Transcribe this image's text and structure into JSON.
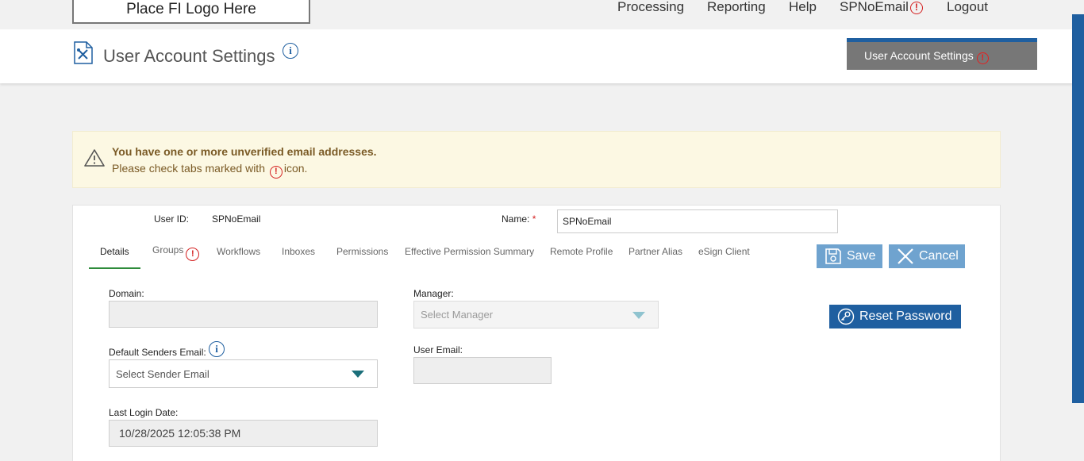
{
  "topbar": {
    "logo_text": "Place FI Logo Here",
    "nav": {
      "processing": "Processing",
      "reporting": "Reporting",
      "help": "Help",
      "user": "SPNoEmail",
      "logout": "Logout"
    },
    "warn_symbol": "!"
  },
  "header": {
    "title": "User Account Settings",
    "info_symbol": "i",
    "tab_label": "User Account Settings"
  },
  "alert": {
    "title": "You have one or more unverified email addresses.",
    "text_before": "Please check tabs marked with",
    "text_after": "icon."
  },
  "form": {
    "user_id_label": "User ID:",
    "user_id_value": "SPNoEmail",
    "name_label": "Name:",
    "required_mark": "*",
    "name_value": "SPNoEmail",
    "tabs": [
      "Details",
      "Groups",
      "Workflows",
      "Inboxes",
      "Permissions",
      "Effective Permission Summary",
      "Remote Profile",
      "Partner Alias",
      "eSign Client"
    ],
    "active_tab": "Details",
    "save_label": "Save",
    "cancel_label": "Cancel",
    "reset_password_label": "Reset Password",
    "domain_label": "Domain:",
    "domain_value": "",
    "manager_label": "Manager:",
    "manager_placeholder": "Select Manager",
    "default_senders_label": "Default Senders Email:",
    "sender_placeholder": "Select Sender Email",
    "user_email_label": "User Email:",
    "user_email_value": "",
    "last_login_label": "Last Login Date:",
    "last_login_value": "10/28/2025 12:05:38 PM"
  },
  "colors": {
    "primary": "#1f5fa0",
    "button_light": "#6fa3cf",
    "warning": "#d42020",
    "alert_bg": "#fcf8e3",
    "active_tab_underline": "#2e8b3b"
  }
}
